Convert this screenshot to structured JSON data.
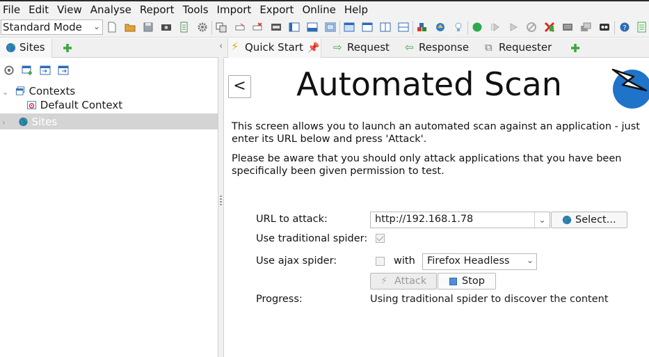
{
  "menu": [
    "File",
    "Edit",
    "View",
    "Analyse",
    "Report",
    "Tools",
    "Import",
    "Export",
    "Online",
    "Help"
  ],
  "toolbar": {
    "mode": "Standard Mode"
  },
  "left": {
    "tab_label": "Sites",
    "tree": {
      "contexts": "Contexts",
      "default_context": "Default Context",
      "sites": "Sites"
    }
  },
  "tabs": {
    "quick_start": "Quick Start",
    "request": "Request",
    "response": "Response",
    "requester": "Requester"
  },
  "scan": {
    "back": "<",
    "title": "Automated Scan",
    "intro": "This screen allows you to launch an automated scan against  an application - just enter its URL below and press 'Attack'.",
    "warning": "Please be aware that you should only attack applications that you have been specifically been given permission to test.",
    "url_label": "URL to attack:",
    "url_value": "http://192.168.1.78",
    "select_label": "Select...",
    "traditional_label": "Use traditional spider:",
    "traditional_checked": true,
    "ajax_label": "Use ajax spider:",
    "ajax_checked": false,
    "with_label": "with",
    "browser": "Firefox Headless",
    "attack_label": "Attack",
    "stop_label": "Stop",
    "progress_label": "Progress:",
    "progress_value": "Using traditional spider to discover the content"
  },
  "colors": {
    "accent_green": "#3aa83a",
    "globe_blue": "#1f73c9",
    "selected_row": "#d4d4d4"
  }
}
